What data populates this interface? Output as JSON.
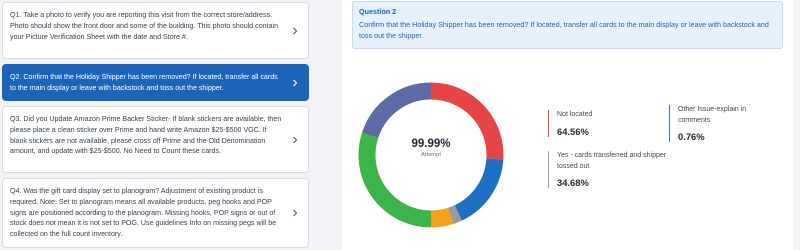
{
  "questions": [
    {
      "text": "Q1. Take a photo to verify you are reporting this visit from the correct store/address. Photo should show the front door and some of the building. This photo should contain your Picture Verification Sheet with the date and Store #."
    },
    {
      "text": "Q2. Confirm that the Holiday Shipper has been removed? If located, transfer all cards to the main display or leave with backstock and toss out the shipper."
    },
    {
      "text": "Q3. Did you Update Amazon Prime Backer Sticker- If blank stickers are available, then please place a clean sticker over Prime and hand write Amazon $25-$500 VGC. If blank stickers are not available, please cross off Prime and the Old Denomination amount, and update with $25-$500. No Need to Count these cards."
    },
    {
      "text": "Q4. Was the gift card display set to planogram? Adjustment of existing product is required. Note: Set to planogram means all available products, peg hooks and POP signs are positioned according to the planogram. Missing hooks, POP signs or out of stock does not mean it is not set to POG. Use guidelines Info on missing pegs will be collected on the full count inventory."
    }
  ],
  "detail": {
    "question_number": "Question 2",
    "question_text": "Confirm that the Holiday Shipper has been removed? If located, transfer all cards to the main display or leave with backstock and toss out the shipper.",
    "center_value": "99.99%",
    "center_label": "Attempt"
  },
  "legend": [
    {
      "label": "Not located",
      "value": "64.56%",
      "color": "#e64545"
    },
    {
      "label": "Yes - cards transferred and shipper tossed out",
      "value": "34.68%",
      "color": "#9aa0a8"
    },
    {
      "label": "Other Issue-explain in comments",
      "value": "0.76%",
      "color": "#3f73c9"
    }
  ],
  "chart_data": {
    "type": "pie",
    "segments": [
      {
        "value": 26,
        "color": "#e64545"
      },
      {
        "value": 17,
        "color": "#1f6fc4"
      },
      {
        "value": 2,
        "color": "#9a9a9a"
      },
      {
        "value": 5,
        "color": "#f5a01a"
      },
      {
        "value": 30,
        "color": "#3cb44a"
      },
      {
        "value": 20,
        "color": "#5b6ba6"
      }
    ]
  }
}
